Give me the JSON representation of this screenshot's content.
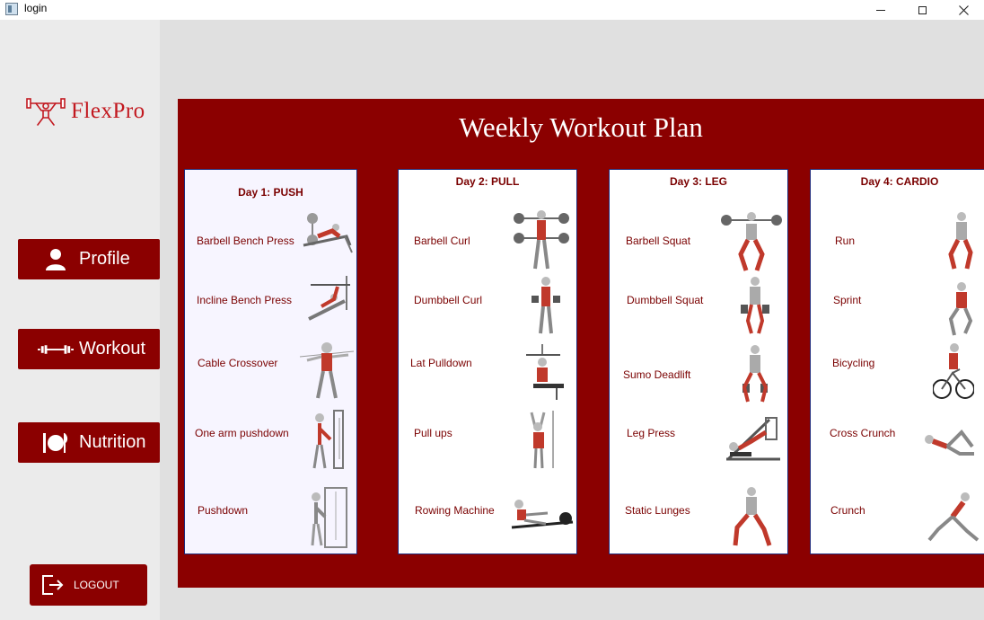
{
  "window": {
    "title": "login"
  },
  "sidebar": {
    "brand": "FlexPro",
    "nav": [
      {
        "label": "Profile",
        "icon": "user-icon"
      },
      {
        "label": "Workout",
        "icon": "dumbbell-icon"
      },
      {
        "label": "Nutrition",
        "icon": "plate-cutlery-icon"
      }
    ],
    "logout": {
      "label": "LOGOUT",
      "icon": "logout-icon"
    }
  },
  "main": {
    "title": "Weekly Workout Plan",
    "days": [
      {
        "title": "Day 1: PUSH",
        "exercises": [
          "Barbell Bench Press",
          "Incline Bench Press",
          "Cable Crossover",
          "One arm pushdown",
          "Pushdown"
        ]
      },
      {
        "title": "Day 2: PULL",
        "exercises": [
          "Barbell Curl",
          "Dumbbell Curl",
          "Lat Pulldown",
          "Pull ups",
          "Rowing Machine"
        ]
      },
      {
        "title": "Day 3: LEG",
        "exercises": [
          "Barbell Squat",
          "Dumbbell Squat",
          "Sumo Deadlift",
          "Leg Press",
          "Static Lunges"
        ]
      },
      {
        "title": "Day 4: CARDIO",
        "exercises": [
          "Run",
          "Sprint",
          "Bicycling",
          "Cross Crunch",
          "Crunch"
        ]
      }
    ]
  },
  "colors": {
    "accent": "#8b0000",
    "brand": "#c2181f",
    "text_accent": "#7a0000"
  }
}
